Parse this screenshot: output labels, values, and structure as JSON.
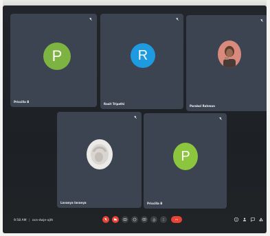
{
  "participants": [
    {
      "name": "Priscilla B",
      "initial": "P",
      "avatar_color": "#7cb342"
    },
    {
      "name": "Rasit Tripathi",
      "initial": "R",
      "avatar_color": "#1e9be0"
    },
    {
      "name": "Parabol Rahman",
      "initial": "",
      "avatar_color": "#d4776b"
    },
    {
      "name": "Lavanya lavanya",
      "initial": "",
      "avatar_color": "#c9c6c2"
    },
    {
      "name": "Priscilla B",
      "initial": "P",
      "avatar_color": "#8cc63f"
    }
  ],
  "meeting": {
    "time": "9:58 AM",
    "separator": "|",
    "code": "oce-dwje-xjth"
  },
  "controls": [
    {
      "name": "mic-off",
      "color": "#ea4335"
    },
    {
      "name": "camera-off",
      "color": "#ea4335"
    },
    {
      "name": "captions",
      "color": "#3c4043"
    },
    {
      "name": "emoji",
      "color": "#3c4043"
    },
    {
      "name": "present",
      "color": "#3c4043"
    },
    {
      "name": "raise-hand",
      "color": "#3c4043"
    },
    {
      "name": "more-options",
      "color": "#3c4043"
    },
    {
      "name": "leave-call",
      "color": "#ea4335"
    }
  ],
  "right_controls": [
    "info",
    "people",
    "chat",
    "activities"
  ]
}
